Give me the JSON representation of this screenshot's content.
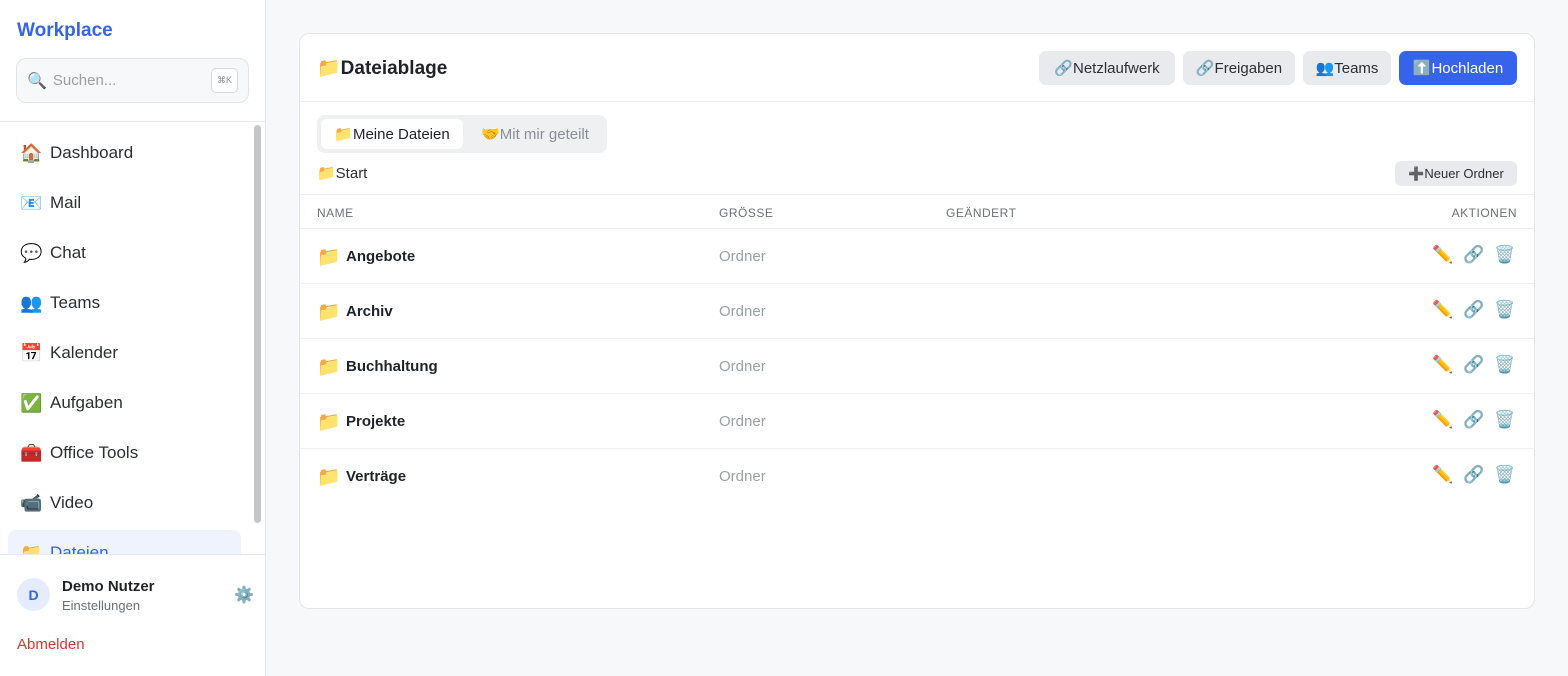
{
  "sidebar": {
    "brand": "Workplace",
    "search": {
      "icon": "🔍",
      "placeholder": "Suchen...",
      "shortcut": "⌘K"
    },
    "items": [
      {
        "icon": "🏠",
        "label": "Dashboard"
      },
      {
        "icon": "📧",
        "label": "Mail"
      },
      {
        "icon": "💬",
        "label": "Chat"
      },
      {
        "icon": "👥",
        "label": "Teams"
      },
      {
        "icon": "📅",
        "label": "Kalender"
      },
      {
        "icon": "✅",
        "label": "Aufgaben"
      },
      {
        "icon": "🧰",
        "label": "Office Tools"
      },
      {
        "icon": "📹",
        "label": "Video"
      },
      {
        "icon": "📁",
        "label": "Dateien"
      }
    ],
    "user": {
      "initial": "D",
      "name": "Demo Nutzer",
      "sub": "Einstellungen",
      "settings_icon": "⚙️"
    },
    "logout": "Abmelden"
  },
  "main": {
    "title": "📁Dateiablage",
    "buttons": {
      "network": "🔗Netzlaufwerk",
      "shares": "🔗Freigaben",
      "teams": "👥Teams",
      "upload": "⬆️Hochladen"
    },
    "tabs": {
      "mine": "📁Meine Dateien",
      "shared": "🤝Mit mir geteilt"
    },
    "breadcrumb": "📁Start",
    "new_folder": "➕Neuer Ordner",
    "columns": {
      "name": "NAME",
      "size": "GRÖSSE",
      "modified": "GEÄNDERT",
      "actions": "AKTIONEN"
    },
    "rows": [
      {
        "icon": "📁",
        "name": "Angebote",
        "size": "Ordner",
        "modified": ""
      },
      {
        "icon": "📁",
        "name": "Archiv",
        "size": "Ordner",
        "modified": ""
      },
      {
        "icon": "📁",
        "name": "Buchhaltung",
        "size": "Ordner",
        "modified": ""
      },
      {
        "icon": "📁",
        "name": "Projekte",
        "size": "Ordner",
        "modified": ""
      },
      {
        "icon": "📁",
        "name": "Verträge",
        "size": "Ordner",
        "modified": ""
      }
    ],
    "action_icons": {
      "edit": "✏️",
      "link": "🔗",
      "delete": "🗑️"
    }
  },
  "colors": {
    "accent": "#3563e9",
    "danger": "#d23b2f"
  }
}
